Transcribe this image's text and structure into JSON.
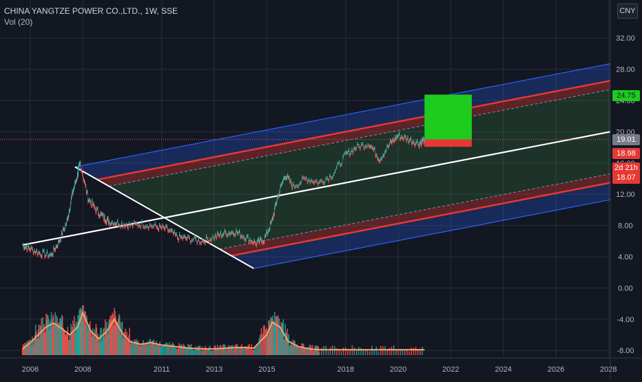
{
  "header": {
    "symbol_title": "CHINA YANGTZE POWER CO.,LTD., 1W, SSE",
    "volume_label": "Vol (20)",
    "currency_button": "CNY"
  },
  "price_tags": {
    "target": "24.75",
    "last": "19.01",
    "stop": "18.98",
    "countdown": "2d 21h",
    "stop2": "18.07"
  },
  "colors": {
    "background": "#131722",
    "grid": "#2a2e39",
    "channel_outer": "#2962ff",
    "channel_red": "#e53935",
    "median": "#ffffff",
    "price_line": "#ff5252",
    "up_bar": "#26a69a",
    "down_bar": "#ef5350",
    "volume_ma": "#ff9e6d",
    "target_box": "#1ecc1e",
    "stop_box": "#e53935"
  },
  "chart_data": {
    "type": "line",
    "title": "CHINA YANGTZE POWER CO.,LTD., 1W, SSE",
    "x_ticks": [
      "2006",
      "2008",
      "2011",
      "2013",
      "2015",
      "2018",
      "2020",
      "2022",
      "2024",
      "2026",
      "2028"
    ],
    "y_ticks": [
      "32.00",
      "28.00",
      "24.00",
      "20.00",
      "16.00",
      "12.00",
      "8.00",
      "4.00",
      "0.00",
      "-4.00",
      "-8.00"
    ],
    "ylim": [
      -9,
      36
    ],
    "grid": true,
    "series": [
      {
        "name": "CHINA YANGTZE POWER CO.,LTD.",
        "x": [
          2005.7,
          2006.0,
          2006.4,
          2006.8,
          2007.1,
          2007.4,
          2007.6,
          2007.8,
          2007.9,
          2008.2,
          2008.5,
          2008.8,
          2009.0,
          2009.4,
          2009.8,
          2010.3,
          2010.8,
          2011.2,
          2011.6,
          2012.0,
          2012.5,
          2013.0,
          2013.4,
          2013.8,
          2014.2,
          2014.6,
          2014.9,
          2015.2,
          2015.4,
          2015.7,
          2016.0,
          2016.5,
          2017.0,
          2017.5,
          2018.0,
          2018.4,
          2018.9,
          2019.3,
          2019.7,
          2020.0,
          2020.4,
          2020.8,
          2021.0
        ],
        "values": [
          5.5,
          5.0,
          4.4,
          4.2,
          6.0,
          8.5,
          12.0,
          14.5,
          16.0,
          11.5,
          10.0,
          9.0,
          8.5,
          8.3,
          8.0,
          8.2,
          7.8,
          7.5,
          6.5,
          6.3,
          6.0,
          6.5,
          7.0,
          7.2,
          6.5,
          5.7,
          6.2,
          8.5,
          11.5,
          14.5,
          13.0,
          14.0,
          13.5,
          14.5,
          17.0,
          18.0,
          18.5,
          16.5,
          18.5,
          19.5,
          19.0,
          18.5,
          19.0
        ]
      }
    ],
    "volume": {
      "name": "Vol",
      "x": [
        2005.7,
        2006.0,
        2006.3,
        2006.6,
        2006.9,
        2007.2,
        2007.5,
        2007.8,
        2008.0,
        2008.3,
        2008.6,
        2008.9,
        2009.2,
        2009.5,
        2009.8,
        2010.2,
        2010.6,
        2011.0,
        2011.5,
        2012.0,
        2012.5,
        2013.0,
        2013.5,
        2014.0,
        2014.5,
        2015.0,
        2015.2,
        2015.5,
        2015.8,
        2016.2,
        2016.6,
        2017.0,
        2018.0,
        2019.0,
        2020.0,
        2021.0
      ],
      "ma": [
        -7.8,
        -7.0,
        -6.0,
        -5.0,
        -4.5,
        -5.2,
        -6.0,
        -5.0,
        -3.2,
        -5.5,
        -6.5,
        -5.6,
        -4.0,
        -5.8,
        -6.9,
        -7.2,
        -7.0,
        -7.3,
        -7.5,
        -7.7,
        -7.8,
        -7.8,
        -7.7,
        -7.6,
        -7.7,
        -6.0,
        -4.4,
        -5.0,
        -6.8,
        -7.5,
        -7.8,
        -7.9,
        -7.9,
        -7.9,
        -7.9,
        -7.9
      ]
    },
    "annotations": {
      "pitchfork_points": [
        [
          2007.7,
          15.5
        ],
        [
          2014.5,
          2.5
        ],
        [
          2005.7,
          5.5
        ]
      ],
      "target_level": 24.75,
      "entry_level": 19.01,
      "stop_level": 18.07
    }
  }
}
